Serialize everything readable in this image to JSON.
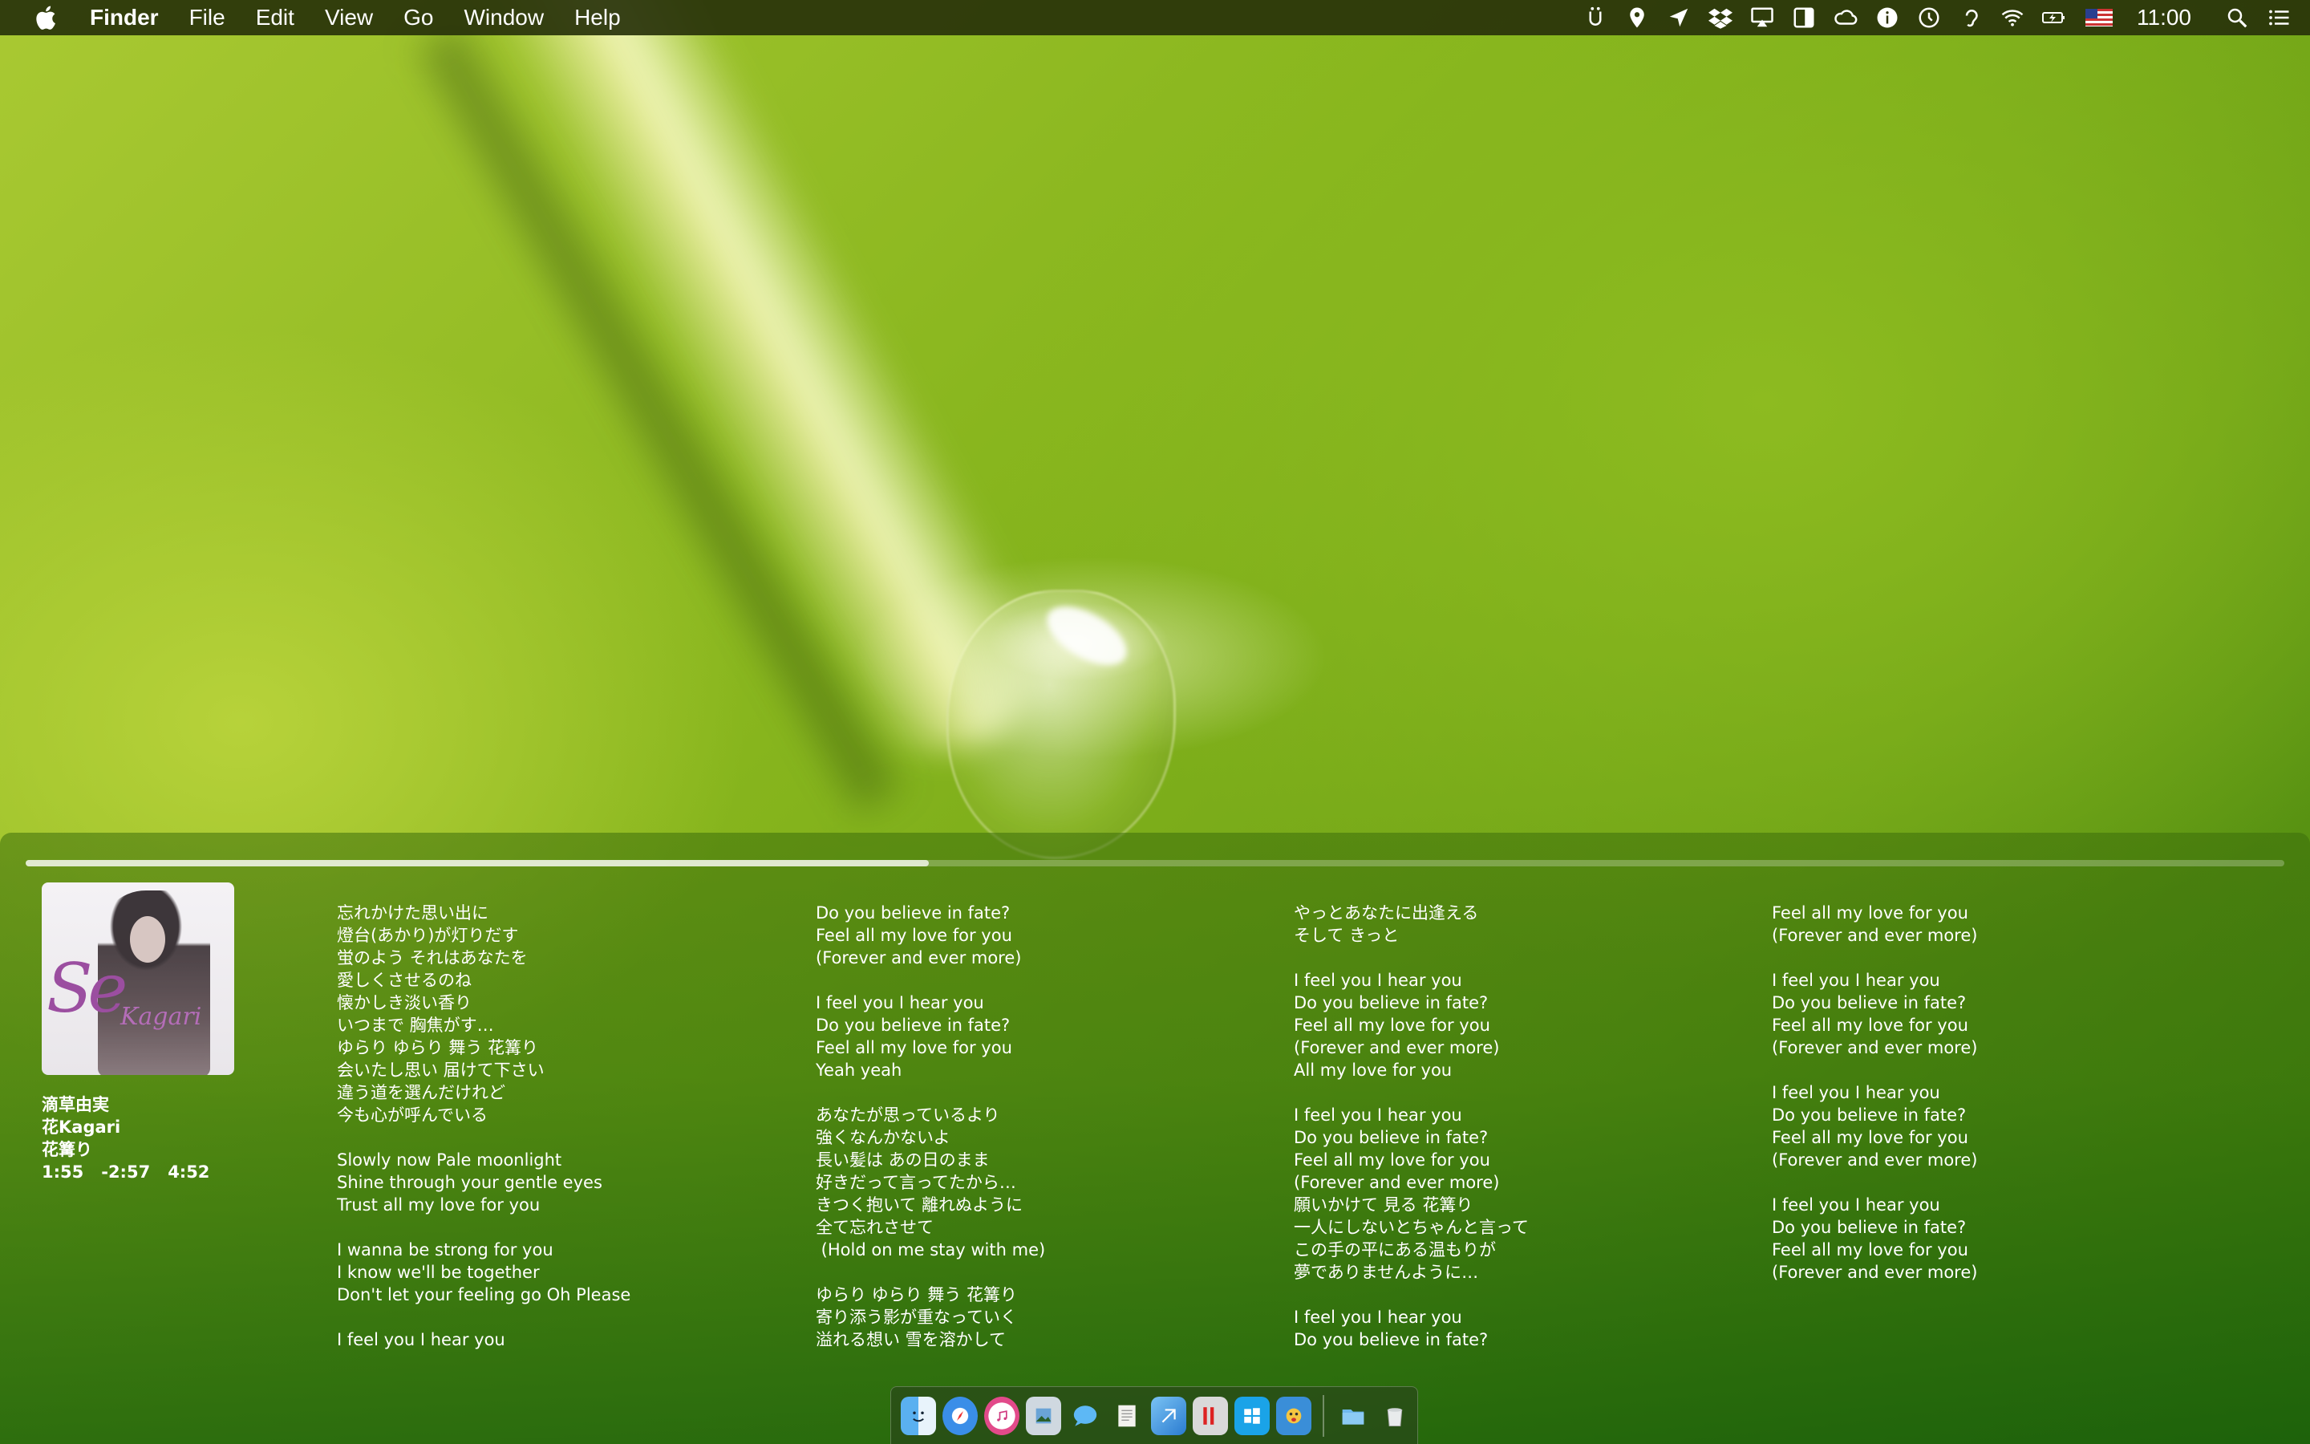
{
  "menubar": {
    "app_name": "Finder",
    "items": [
      "File",
      "Edit",
      "View",
      "Go",
      "Window",
      "Help"
    ],
    "status_icons": [
      "usb-icon",
      "location-pin-icon",
      "location-arrow-icon",
      "dropbox-icon",
      "airplay-icon",
      "sidebar-icon",
      "creative-cloud-icon",
      "info-icon",
      "time-machine-icon",
      "hearing-icon",
      "wifi-icon",
      "battery-charging-icon",
      "us-flag-icon"
    ],
    "clock": "11:00"
  },
  "player": {
    "progress_fraction": 0.4,
    "artist": "滴草由実",
    "album": "花Kagari",
    "title": "花篝り",
    "elapsed": "1:55",
    "remaining": "-2:57",
    "duration": "4:52",
    "album_art_text": "Kagari"
  },
  "lyrics": {
    "col1": [
      "忘れかけた思い出に",
      "燈台(あかり)が灯りだす",
      "蛍のよう それはあなたを",
      "愛しくさせるのね",
      "懐かしき淡い香り",
      "いつまで 胸焦がす…",
      "ゆらり ゆらり 舞う 花篝り",
      "会いたし思い 届けて下さい",
      "違う道を選んだけれど",
      "今も心が呼んでいる",
      "",
      "Slowly now Pale moonlight",
      "Shine through your gentle eyes",
      "Trust all my love for you",
      "",
      "I wanna be strong for you",
      "I know we'll be together",
      "Don't let your feeling go Oh Please",
      "",
      "I feel you I hear you"
    ],
    "col2": [
      "Do you believe in fate?",
      "Feel all my love for you",
      "(Forever and ever more)",
      "",
      "I feel you I hear you",
      "Do you believe in fate?",
      "Feel all my love for you",
      "Yeah yeah",
      "",
      "あなたが思っているより",
      "強くなんかないよ",
      "長い髪は あの日のまま",
      "好きだって言ってたから…",
      "きつく抱いて 離れぬように",
      "全て忘れさせて",
      " (Hold on me stay with me)",
      "",
      "ゆらり ゆらり 舞う 花篝り",
      "寄り添う影が重なっていく",
      "溢れる想い 雪を溶かして"
    ],
    "col3": [
      "やっとあなたに出逢える",
      "そして きっと",
      "",
      "I feel you I hear you",
      "Do you believe in fate?",
      "Feel all my love for you",
      "(Forever and ever more)",
      "All my love for you",
      "",
      "I feel you I hear you",
      "Do you believe in fate?",
      "Feel all my love for you",
      "(Forever and ever more)",
      "願いかけて 見る 花篝り",
      "一人にしないとちゃんと言って",
      "この手の平にある温もりが",
      "夢でありませんように…",
      "",
      "I feel you I hear you",
      "Do you believe in fate?"
    ],
    "col4": [
      "Feel all my love for you",
      "(Forever and ever more)",
      "",
      "I feel you I hear you",
      "Do you believe in fate?",
      "Feel all my love for you",
      "(Forever and ever more)",
      "",
      "I feel you I hear you",
      "Do you believe in fate?",
      "Feel all my love for you",
      "(Forever and ever more)",
      "",
      "I feel you I hear you",
      "Do you believe in fate?",
      "Feel all my love for you",
      "(Forever and ever more)"
    ]
  },
  "dock": {
    "apps": [
      "finder-icon",
      "safari-icon",
      "itunes-icon",
      "preview-icon",
      "messages-icon",
      "textedit-icon",
      "xcode-icon",
      "parallels-icon",
      "windows-icon",
      "feedback-icon"
    ],
    "right": [
      "folder-icon",
      "trash-icon"
    ]
  },
  "colors": {
    "menubar_bg": "#2d320a",
    "panel_bg": "#3c6e0a",
    "accent_purple": "#9b4ea0"
  }
}
